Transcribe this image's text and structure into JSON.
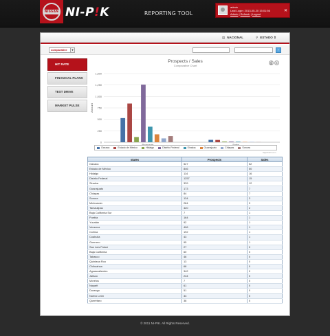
{
  "header": {
    "logo_badge": "NISSAN",
    "brand_prefix": "NI-P",
    "brand_accent": "!",
    "brand_suffix": "K",
    "tool_title": "REPORTING TOOL",
    "user": {
      "name": "admin",
      "last_login": "Last Login: 2013-05-20 15:01:56",
      "link_admin": "Admin",
      "link_refresh": "Refresh",
      "link_logout": "Logout",
      "close_icon": "close-icon"
    }
  },
  "nav": {
    "nacional_label": "NACIONAL",
    "estado_label": "ESTADO"
  },
  "filter": {
    "select_value": "comparative"
  },
  "side_tabs": [
    "HIT RATE",
    "FINANCIAL PLANS",
    "TEST DRIVE",
    "MARKET PULSE"
  ],
  "chart_data": {
    "type": "bar",
    "title": "Prospects / Sales",
    "subtitle": "Comparative Chart",
    "ylabel": "Amount",
    "categories": [
      "Prospects",
      "Sales"
    ],
    "ylim": [
      0,
      1500
    ],
    "yticks": [
      "0",
      "250",
      "500",
      "750",
      "1,000",
      "1,250",
      "1,500"
    ],
    "series": [
      {
        "name": "Oaxaca",
        "color": "#4572A7",
        "values": [
          527,
          52
        ]
      },
      {
        "name": "Estado de México",
        "color": "#AA4643",
        "values": [
          846,
          50
        ]
      },
      {
        "name": "Hidalgo",
        "color": "#89A54E",
        "values": [
          114,
          16
        ]
      },
      {
        "name": "Distrito Federal",
        "color": "#80699B",
        "values": [
          1257,
          15
        ]
      },
      {
        "name": "Sinaloa",
        "color": "#3D96AE",
        "values": [
          339,
          12
        ]
      },
      {
        "name": "Guanajuato",
        "color": "#DB843D",
        "values": [
          173,
          7
        ]
      },
      {
        "name": "Chiapas",
        "color": "#92A8CD",
        "values": [
          84,
          7
        ]
      },
      {
        "name": "Sonora",
        "color": "#A47D7C",
        "values": [
          134,
          3
        ]
      }
    ],
    "credit": "Highcharts.com"
  },
  "table": {
    "headers": [
      "states",
      "Prospects",
      "Sales"
    ],
    "rows": [
      [
        "Oaxaca",
        "527",
        "52"
      ],
      [
        "Estado de México",
        "846",
        "50"
      ],
      [
        "Hidalgo",
        "114",
        "16"
      ],
      [
        "Distrito Federal",
        "1257",
        "15"
      ],
      [
        "Sinaloa",
        "339",
        "12"
      ],
      [
        "Guanajuato",
        "173",
        "7"
      ],
      [
        "Chiapas",
        "84",
        "7"
      ],
      [
        "Sonora",
        "134",
        "3"
      ],
      [
        "Michoacán",
        "284",
        "3"
      ],
      [
        "Tamaulipas",
        "420",
        "2"
      ],
      [
        "Baja California Sur",
        "7",
        "1"
      ],
      [
        "Puebla",
        "164",
        "1"
      ],
      [
        "Yucatán",
        "92",
        "1"
      ],
      [
        "Veracruz",
        "406",
        "1"
      ],
      [
        "Colima",
        "192",
        "1"
      ],
      [
        "Coahuila",
        "43",
        "1"
      ],
      [
        "Guerrero",
        "95",
        "1"
      ],
      [
        "San Luis Potosí",
        "27",
        "0"
      ],
      [
        "Baja California",
        "60",
        "0"
      ],
      [
        "Tabasco",
        "46",
        "0"
      ],
      [
        "Quintana Roo",
        "13",
        "0"
      ],
      [
        "Chihuahua",
        "68",
        "0"
      ],
      [
        "Aguascalientes",
        "342",
        "0"
      ],
      [
        "Jalisco",
        "244",
        "0"
      ],
      [
        "Morelos",
        "7",
        "0"
      ],
      [
        "Nayarit",
        "61",
        "0"
      ],
      [
        "Durango",
        "51",
        "0"
      ],
      [
        "Nuevo León",
        "34",
        "0"
      ],
      [
        "Querétaro",
        "38",
        "0"
      ]
    ]
  },
  "footer": "© 2011 NI-PIK. All Rights Reserved."
}
